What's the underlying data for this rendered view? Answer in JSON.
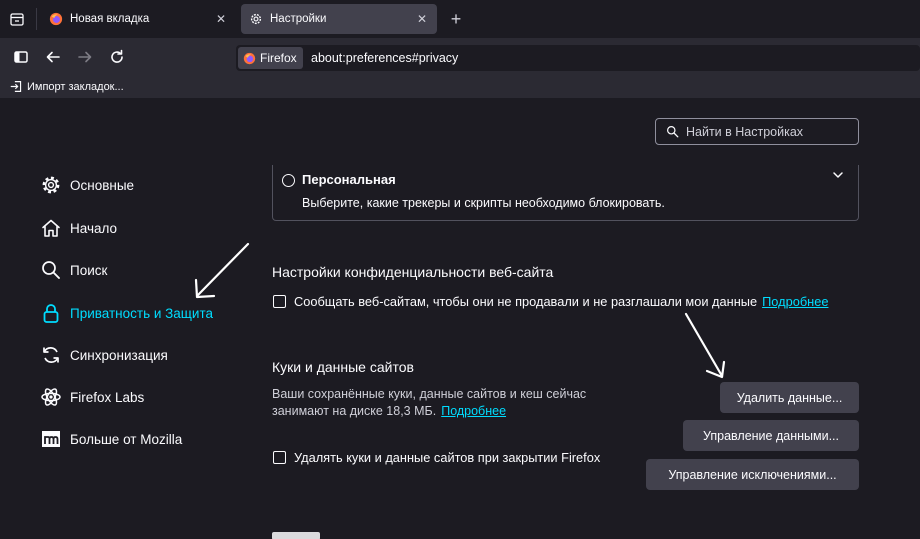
{
  "tabs": [
    {
      "title": "Новая вкладка",
      "active": false
    },
    {
      "title": "Настройки",
      "active": true
    }
  ],
  "urlbar": {
    "identity_label": "Firefox",
    "url": "about:preferences#privacy"
  },
  "bookmarks": {
    "import_label": "Импорт закладок..."
  },
  "search": {
    "placeholder": "Найти в Настройках"
  },
  "sidebar": {
    "items": [
      {
        "label": "Основные",
        "icon": "gear-icon"
      },
      {
        "label": "Начало",
        "icon": "home-icon"
      },
      {
        "label": "Поиск",
        "icon": "search-icon"
      },
      {
        "label": "Приватность и Защита",
        "icon": "lock-icon",
        "selected": true
      },
      {
        "label": "Синхронизация",
        "icon": "sync-icon"
      },
      {
        "label": "Firefox Labs",
        "icon": "flask-icon"
      },
      {
        "label": "Больше от Mozilla",
        "icon": "mozilla-icon"
      }
    ]
  },
  "tracking": {
    "custom_label": "Персональная",
    "custom_desc": "Выберите, какие трекеры и скрипты необходимо блокировать."
  },
  "website_privacy": {
    "heading": "Настройки конфиденциальности веб-сайта",
    "gpc_label": "Сообщать веб-сайтам, чтобы они не продавали и не разглашали мои данные",
    "learn_more": "Подробнее"
  },
  "cookies": {
    "heading": "Куки и данные сайтов",
    "desc": "Ваши сохранённые куки, данные сайтов и кеш сейчас занимают на диске 18,3 МБ.",
    "learn_more": "Подробнее",
    "clear_button": "Удалить данные...",
    "manage_button": "Управление данными...",
    "exceptions_button": "Управление исключениями...",
    "delete_on_close_label": "Удалять куки и данные сайтов при закрытии Firefox"
  },
  "colors": {
    "accent": "#00ddff",
    "background": "#1c1b22",
    "toolbar": "#2b2a33",
    "button": "#42414d"
  }
}
